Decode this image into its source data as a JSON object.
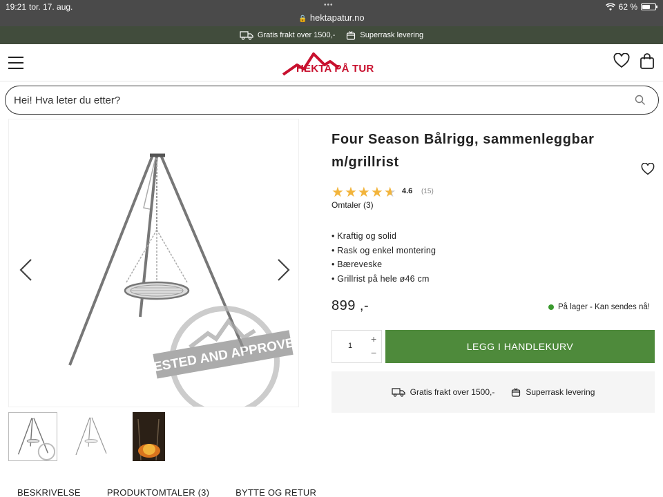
{
  "status_bar": {
    "time": "19:21",
    "date": "tor. 17. aug.",
    "url": "hektapatur.no",
    "battery": "62 %"
  },
  "promo": {
    "free_shipping": "Gratis frakt over 1500,-",
    "fast_delivery": "Superrask levering"
  },
  "header": {
    "logo_text": "HEKTA PÅ TUR"
  },
  "search": {
    "placeholder": "Hei! Hva leter du etter?"
  },
  "product": {
    "title": "Four Season Bålrigg, sammenleggbar m/grillrist",
    "rating": "4.6",
    "rating_count": "(15)",
    "reviews_link": "Omtaler (3)",
    "features": [
      "• Kraftig og solid",
      "• Rask og enkel montering",
      "• Bæreveske",
      "• Grillrist på hele ø46 cm"
    ],
    "price": "899 ,-",
    "stock": "På lager - Kan sendes nå!",
    "quantity": "1",
    "add_to_cart": "LEGG I HANDLEKURV"
  },
  "shipping_box": {
    "free_shipping": "Gratis frakt over 1500,-",
    "fast_delivery": "Superrask levering"
  },
  "tabs": [
    "BESKRIVELSE",
    "PRODUKTOMTALER (3)",
    "BYTTE OG RETUR"
  ],
  "colors": {
    "promo_bar": "#414c3c",
    "brand_red": "#c8102e",
    "cart_button": "#4e8a3b",
    "stars": "#f2b43b",
    "stock_dot": "#3a9a2e"
  },
  "icons": [
    "menu-icon",
    "logo-mountain-icon",
    "heart-icon",
    "shopping-bag-icon",
    "search-icon",
    "truck-icon",
    "gift-box-icon",
    "chevron-left-icon",
    "chevron-right-icon",
    "star-icon"
  ]
}
